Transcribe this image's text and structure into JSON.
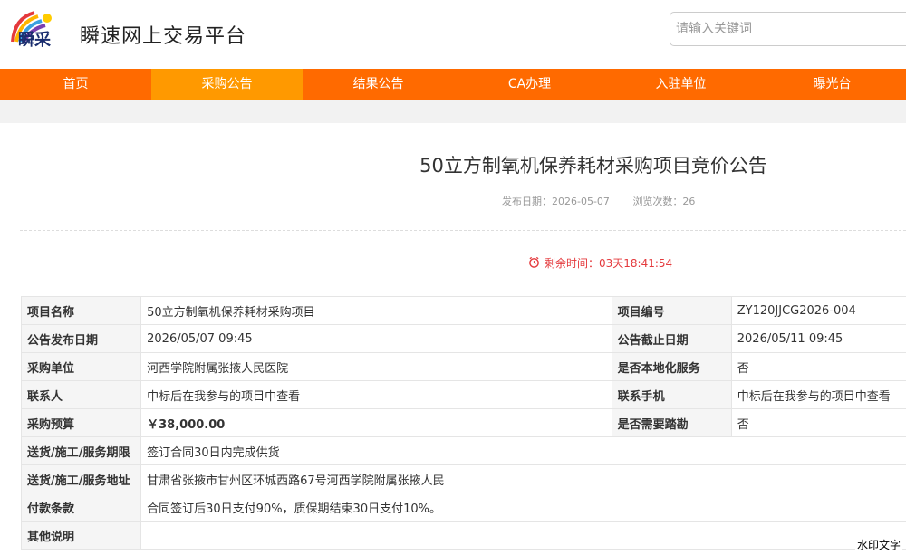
{
  "header": {
    "logo_text": "瞬采",
    "site_name": "瞬速网上交易平台",
    "search_placeholder": "请输入关键词"
  },
  "nav": [
    {
      "label": "首页",
      "active": false
    },
    {
      "label": "采购公告",
      "active": true
    },
    {
      "label": "结果公告",
      "active": false
    },
    {
      "label": "CA办理",
      "active": false
    },
    {
      "label": "入驻单位",
      "active": false
    },
    {
      "label": "曝光台",
      "active": false
    }
  ],
  "notice": {
    "title": "50立方制氧机保养耗材采购项目竞价公告",
    "publish_date": "发布日期：2026-05-07",
    "views": "浏览次数：26",
    "countdown": "剩余时间：03天18:41:54"
  },
  "table": {
    "rows": [
      {
        "k1": "项目名称",
        "v1": "50立方制氧机保养耗材采购项目",
        "k2": "项目编号",
        "v2": "ZY120JJCG2026-004"
      },
      {
        "k1": "公告发布日期",
        "v1": "2026/05/07 09:45",
        "k2": "公告截止日期",
        "v2": "2026/05/11 09:45"
      },
      {
        "k1": "采购单位",
        "v1": "河西学院附属张掖人民医院",
        "k2": "是否本地化服务",
        "v2": "否"
      },
      {
        "k1": "联系人",
        "v1": "中标后在我参与的项目中查看",
        "k2": "联系手机",
        "v2": "中标后在我参与的项目中查看"
      },
      {
        "k1": "采购预算",
        "v1": "￥38,000.00",
        "k2": "是否需要踏勘",
        "v2": "否"
      }
    ],
    "wide_rows": [
      {
        "k": "送货/施工/服务期限",
        "v": "签订合同30日内完成供货"
      },
      {
        "k": "送货/施工/服务地址",
        "v": "甘肃省张掖市甘州区环城西路67号河西学院附属张掖人民"
      },
      {
        "k": "付款条款",
        "v": "合同签订后30日支付90%，质保期结束30日支付10%。"
      },
      {
        "k": "其他说明",
        "v": ""
      }
    ]
  },
  "watermark": "水印文字",
  "colors": {
    "nav_bg": "#ff6a00",
    "nav_active": "#ff9900",
    "alert_red": "#e4393c"
  }
}
